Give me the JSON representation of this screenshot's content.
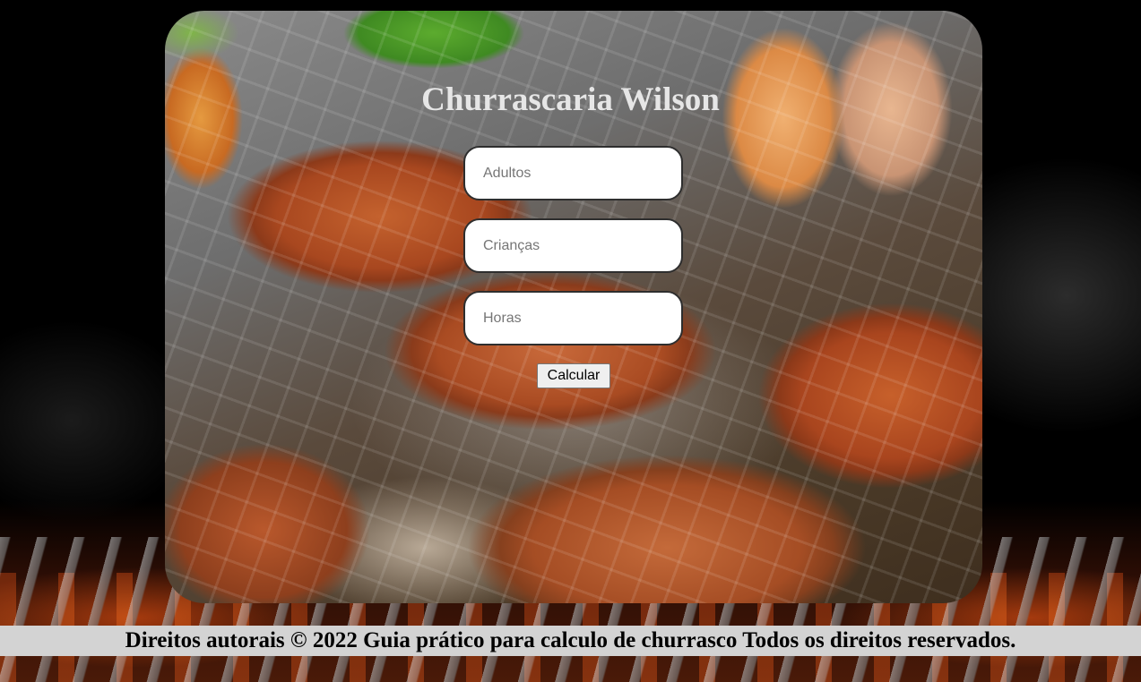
{
  "page": {
    "title": "Churrascaria Wilson"
  },
  "form": {
    "adults_placeholder": "Adultos",
    "children_placeholder": "Crianças",
    "hours_placeholder": "Horas",
    "calculate_label": "Calcular"
  },
  "footer": {
    "text": "Direitos autorais © 2022 Guia prático para calculo de churrasco Todos os direitos reservados."
  },
  "colors": {
    "title": "#e6e6e6",
    "footer_background": "#d3d3d3",
    "page_background": "#000000"
  }
}
